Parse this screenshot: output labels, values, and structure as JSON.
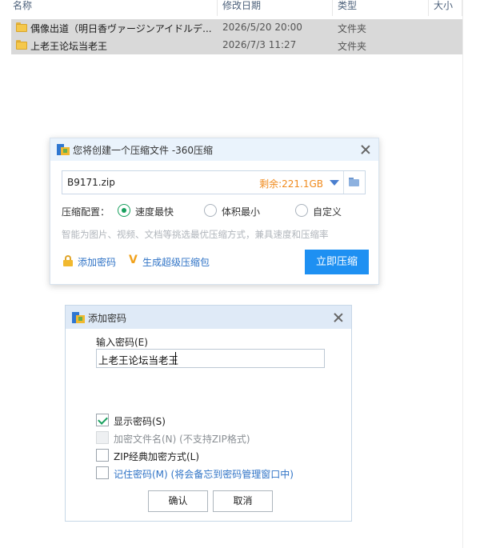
{
  "explorer": {
    "columns": {
      "name": "名称",
      "date": "修改日期",
      "type": "类型",
      "size": "大小"
    },
    "rows": [
      {
        "name": "偶像出道（明日香ヴァージンアイドルデ...",
        "date": "2026/5/20 20:00",
        "type": "文件夹"
      },
      {
        "name": "上老王论坛当老王",
        "date": "2026/7/3 11:27",
        "type": "文件夹"
      }
    ]
  },
  "compress_dialog": {
    "title": "您将创建一个压缩文件 -360压缩",
    "filename": "B9171.zip",
    "remaining": "剩余:221.1GB",
    "config_label": "压缩配置：",
    "options": [
      {
        "label": "速度最快",
        "selected": true
      },
      {
        "label": "体积最小",
        "selected": false
      },
      {
        "label": "自定义",
        "selected": false
      }
    ],
    "hint": "智能为图片、视频、文档等挑选最优压缩方式，兼具速度和压缩率",
    "add_password_link": "添加密码",
    "super_pack_link": "生成超级压缩包",
    "compress_button": "立即压缩"
  },
  "password_dialog": {
    "title": "添加密码",
    "input_label": "输入密码(E)",
    "password_value": "上老王论坛当老王",
    "checkboxes": [
      {
        "label": "显示密码(S)",
        "checked": true,
        "disabled": false
      },
      {
        "label": "加密文件名(N) (不支持ZIP格式)",
        "checked": false,
        "disabled": true
      },
      {
        "label": "ZIP经典加密方式(L)",
        "checked": false,
        "disabled": false
      },
      {
        "label": "记住密码(M) (将会备忘到密码管理窗口中)",
        "checked": false,
        "disabled": false
      }
    ],
    "ok_button": "确认",
    "cancel_button": "取消"
  },
  "colors": {
    "accent_blue": "#1e90f2",
    "remaining_orange": "#f08a1c",
    "check_green": "#18a05e",
    "link_blue": "#2f73c6"
  }
}
